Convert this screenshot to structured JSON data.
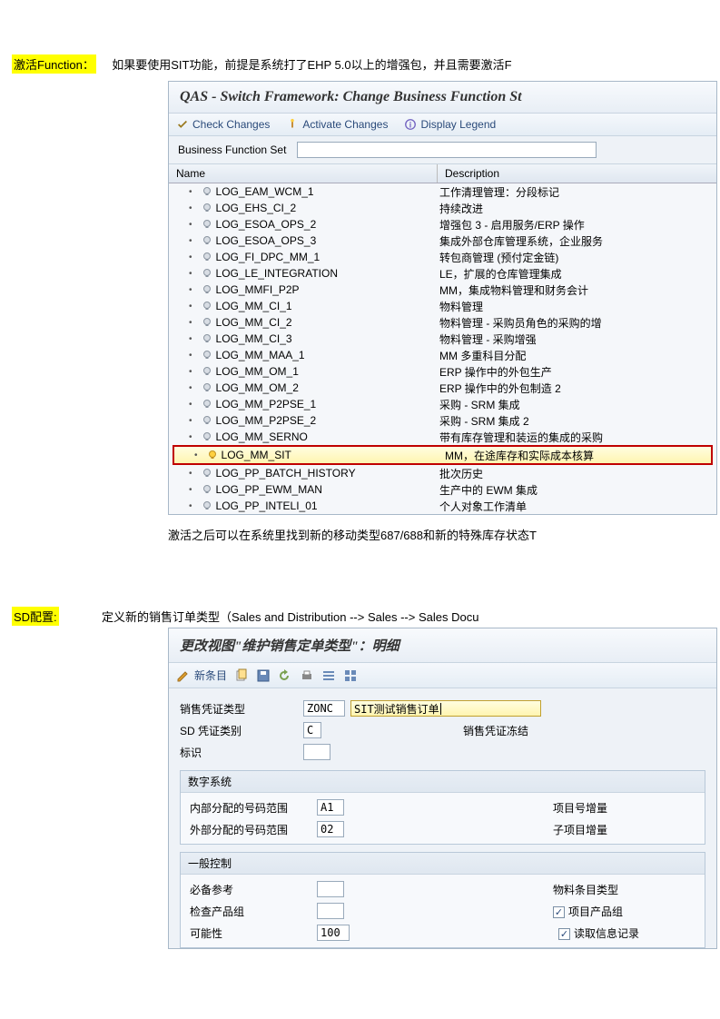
{
  "section1": {
    "label": "激活Function：",
    "text": "如果要使用SIT功能，前提是系统打了EHP 5.0以上的增强包，并且需要激活F",
    "window_title": "QAS - Switch Framework: Change Business Function St",
    "toolbar": {
      "check": "Check Changes",
      "activate": "Activate Changes",
      "legend": "Display Legend"
    },
    "bfs_label": "Business Function Set",
    "col_name": "Name",
    "col_desc": "Description",
    "rows": [
      {
        "name": "LOG_EAM_WCM_1",
        "desc": "工作清理管理：分段标记",
        "on": false
      },
      {
        "name": "LOG_EHS_CI_2",
        "desc": "持续改进",
        "on": false
      },
      {
        "name": "LOG_ESOA_OPS_2",
        "desc": "增强包 3 - 启用服务/ERP 操作",
        "on": false
      },
      {
        "name": "LOG_ESOA_OPS_3",
        "desc": "集成外部仓库管理系统，企业服务",
        "on": false
      },
      {
        "name": "LOG_FI_DPC_MM_1",
        "desc": "转包商管理 (预付定金链)",
        "on": false
      },
      {
        "name": "LOG_LE_INTEGRATION",
        "desc": "LE，扩展的仓库管理集成",
        "on": false
      },
      {
        "name": "LOG_MMFI_P2P",
        "desc": "MM，集成物料管理和财务会计",
        "on": false
      },
      {
        "name": "LOG_MM_CI_1",
        "desc": "物料管理",
        "on": false
      },
      {
        "name": "LOG_MM_CI_2",
        "desc": "物料管理 - 采购员角色的采购的增",
        "on": false
      },
      {
        "name": "LOG_MM_CI_3",
        "desc": "物料管理 - 采购增强",
        "on": false
      },
      {
        "name": "LOG_MM_MAA_1",
        "desc": "MM 多重科目分配",
        "on": false
      },
      {
        "name": "LOG_MM_OM_1",
        "desc": "ERP 操作中的外包生产",
        "on": false
      },
      {
        "name": "LOG_MM_OM_2",
        "desc": "ERP 操作中的外包制造 2",
        "on": false
      },
      {
        "name": "LOG_MM_P2PSE_1",
        "desc": "采购 - SRM 集成",
        "on": false
      },
      {
        "name": "LOG_MM_P2PSE_2",
        "desc": "采购 - SRM 集成 2",
        "on": false
      },
      {
        "name": "LOG_MM_SERNO",
        "desc": "带有库存管理和装运的集成的采购",
        "on": false
      },
      {
        "name": "LOG_MM_SIT",
        "desc": "MM，在途库存和实际成本核算",
        "on": true,
        "highlight": true
      },
      {
        "name": "LOG_PP_BATCH_HISTORY",
        "desc": "批次历史",
        "on": false
      },
      {
        "name": "LOG_PP_EWM_MAN",
        "desc": "生产中的 EWM 集成",
        "on": false
      },
      {
        "name": "LOG_PP_INTELI_01",
        "desc": "个人对象工作清单",
        "on": false
      }
    ],
    "after_text": "激活之后可以在系统里找到新的移动类型687/688和新的特殊库存状态T"
  },
  "section2": {
    "label": "SD配置:",
    "text": "定义新的销售订单类型（Sales and Distribution --> Sales --> Sales Docu",
    "window_title": "更改视图\"维护销售定单类型\"：明细",
    "new_entry": "新条目",
    "fields": {
      "sales_doc_type_label": "销售凭证类型",
      "sales_doc_type_val": "ZONC",
      "sales_doc_type_desc": "SIT测试销售订单",
      "sd_cat_label": "SD 凭证类别",
      "sd_cat_val": "C",
      "freeze_label": "销售凭证冻结",
      "indicator_label": "标识"
    },
    "group_num": {
      "title": "数字系统",
      "int_range_label": "内部分配的号码范围",
      "int_range_val": "A1",
      "ext_range_label": "外部分配的号码范围",
      "ext_range_val": "02",
      "item_inc_label": "项目号增量",
      "subitem_inc_label": "子项目增量"
    },
    "group_gen": {
      "title": "一般控制",
      "ref_label": "必备参考",
      "mat_type_label": "物料条目类型",
      "check_grp_label": "检查产品组",
      "item_grp_label": "项目产品组",
      "prob_label": "可能性",
      "prob_val": "100",
      "read_info_label": "读取信息记录"
    }
  }
}
